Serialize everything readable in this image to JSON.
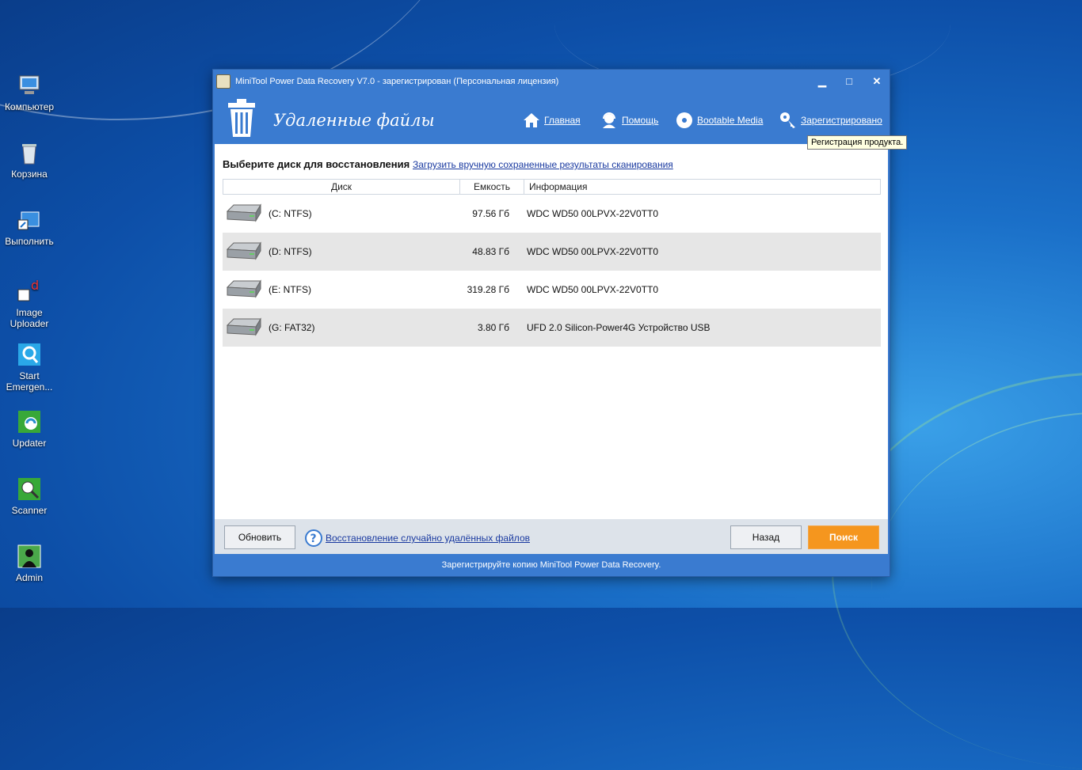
{
  "desktop": {
    "icons": [
      {
        "label": "Компьютер",
        "icon": "computer-icon"
      },
      {
        "label": "Корзина",
        "icon": "recycle-bin-icon"
      },
      {
        "label": "Выполнить",
        "icon": "run-icon"
      },
      {
        "label": "Image Uploader",
        "icon": "image-uploader-icon"
      },
      {
        "label": "Start Emergen...",
        "icon": "emergency-icon"
      },
      {
        "label": "Updater",
        "icon": "updater-icon"
      },
      {
        "label": "Scanner",
        "icon": "scanner-icon"
      },
      {
        "label": "Admin",
        "icon": "admin-icon"
      }
    ]
  },
  "window": {
    "title": "MiniTool Power Data Recovery V7.0 - зарегистрирован (Персональная лицензия)",
    "controls": {
      "minimize": "▁",
      "maximize": "□",
      "close": "✕"
    },
    "section_title": "Удаленные файлы",
    "nav": {
      "home": "Главная",
      "help": "Помощь",
      "bootable": "Bootable Media",
      "registered": "Зарегистрировано"
    },
    "tooltip": "Регистрация продукта.",
    "prompt": "Выберите диск для восстановления",
    "load_link": "Загрузить вручную сохраненные результаты сканирования",
    "table": {
      "headers": {
        "disk": "Диск",
        "capacity": "Емкость",
        "info": "Информация"
      },
      "rows": [
        {
          "disk": "(C: NTFS)",
          "capacity": "97.56 Гб",
          "info": "WDC WD50 00LPVX-22V0TT0"
        },
        {
          "disk": "(D: NTFS)",
          "capacity": "48.83 Гб",
          "info": "WDC WD50 00LPVX-22V0TT0"
        },
        {
          "disk": "(E: NTFS)",
          "capacity": "319.28 Гб",
          "info": "WDC WD50 00LPVX-22V0TT0"
        },
        {
          "disk": "(G: FAT32)",
          "capacity": "3.80 Гб",
          "info": "UFD 2.0 Silicon-Power4G Устройство USB"
        }
      ]
    },
    "footer": {
      "refresh": "Обновить",
      "help_link": "Восстановление случайно удалённых файлов",
      "back": "Назад",
      "search": "Поиск"
    },
    "status": "Зарегистрируйте копию MiniTool Power Data Recovery."
  },
  "colors": {
    "accent": "#3a7bd0",
    "search": "#f5961e",
    "link": "#1a3aa0",
    "tooltip_bg": "#ffffe1"
  }
}
